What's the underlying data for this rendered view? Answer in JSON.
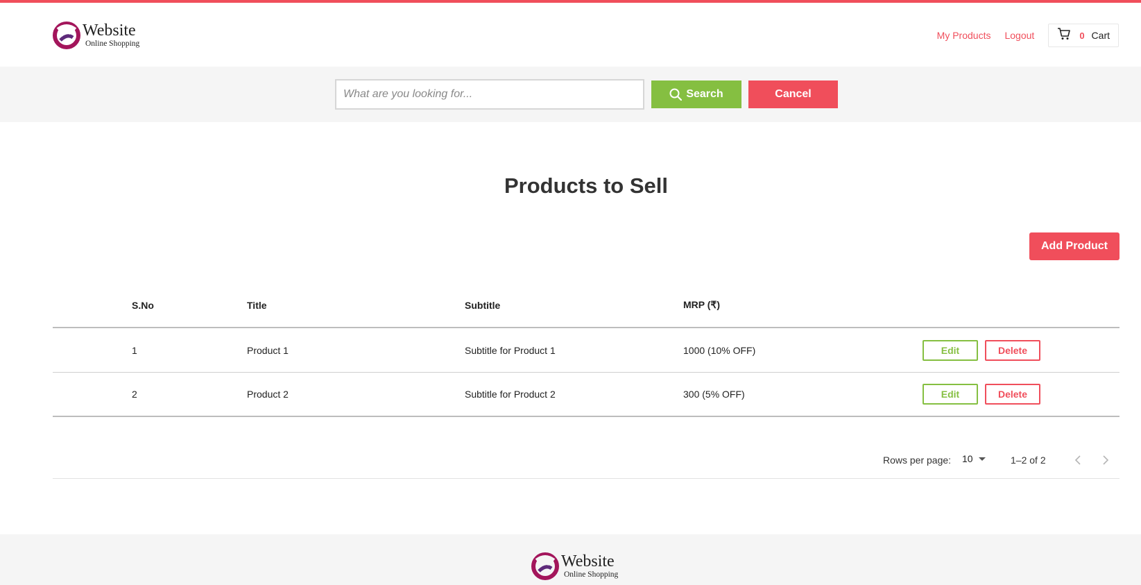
{
  "colors": {
    "accent": "#f04e5b",
    "success": "#85bf41",
    "band": "#f5f5f5"
  },
  "header": {
    "logo": {
      "name": "Website",
      "tagline": "Online Shopping"
    },
    "nav": {
      "my_products": "My Products",
      "logout": "Logout"
    },
    "cart": {
      "count": "0",
      "label": "Cart",
      "icon": "cart-icon"
    }
  },
  "search": {
    "placeholder": "What are you looking for...",
    "value": "",
    "search_label": "Search",
    "cancel_label": "Cancel"
  },
  "main": {
    "title": "Products to Sell",
    "add_label": "Add Product",
    "table": {
      "columns": [
        "S.No",
        "Title",
        "Subtitle",
        "MRP (₹)",
        ""
      ],
      "rows": [
        {
          "sno": "1",
          "title": "Product 1",
          "subtitle": "Subtitle for Product 1",
          "mrp": "1000 (10% OFF)",
          "edit": "Edit",
          "delete": "Delete"
        },
        {
          "sno": "2",
          "title": "Product 2",
          "subtitle": "Subtitle for Product 2",
          "mrp": "300 (5% OFF)",
          "edit": "Edit",
          "delete": "Delete"
        }
      ]
    },
    "pagination": {
      "rows_per_page_label": "Rows per page:",
      "rows_per_page": "10",
      "range": "1–2 of 2"
    }
  },
  "footer": {
    "logo": {
      "name": "Website",
      "tagline": "Online Shopping"
    }
  }
}
